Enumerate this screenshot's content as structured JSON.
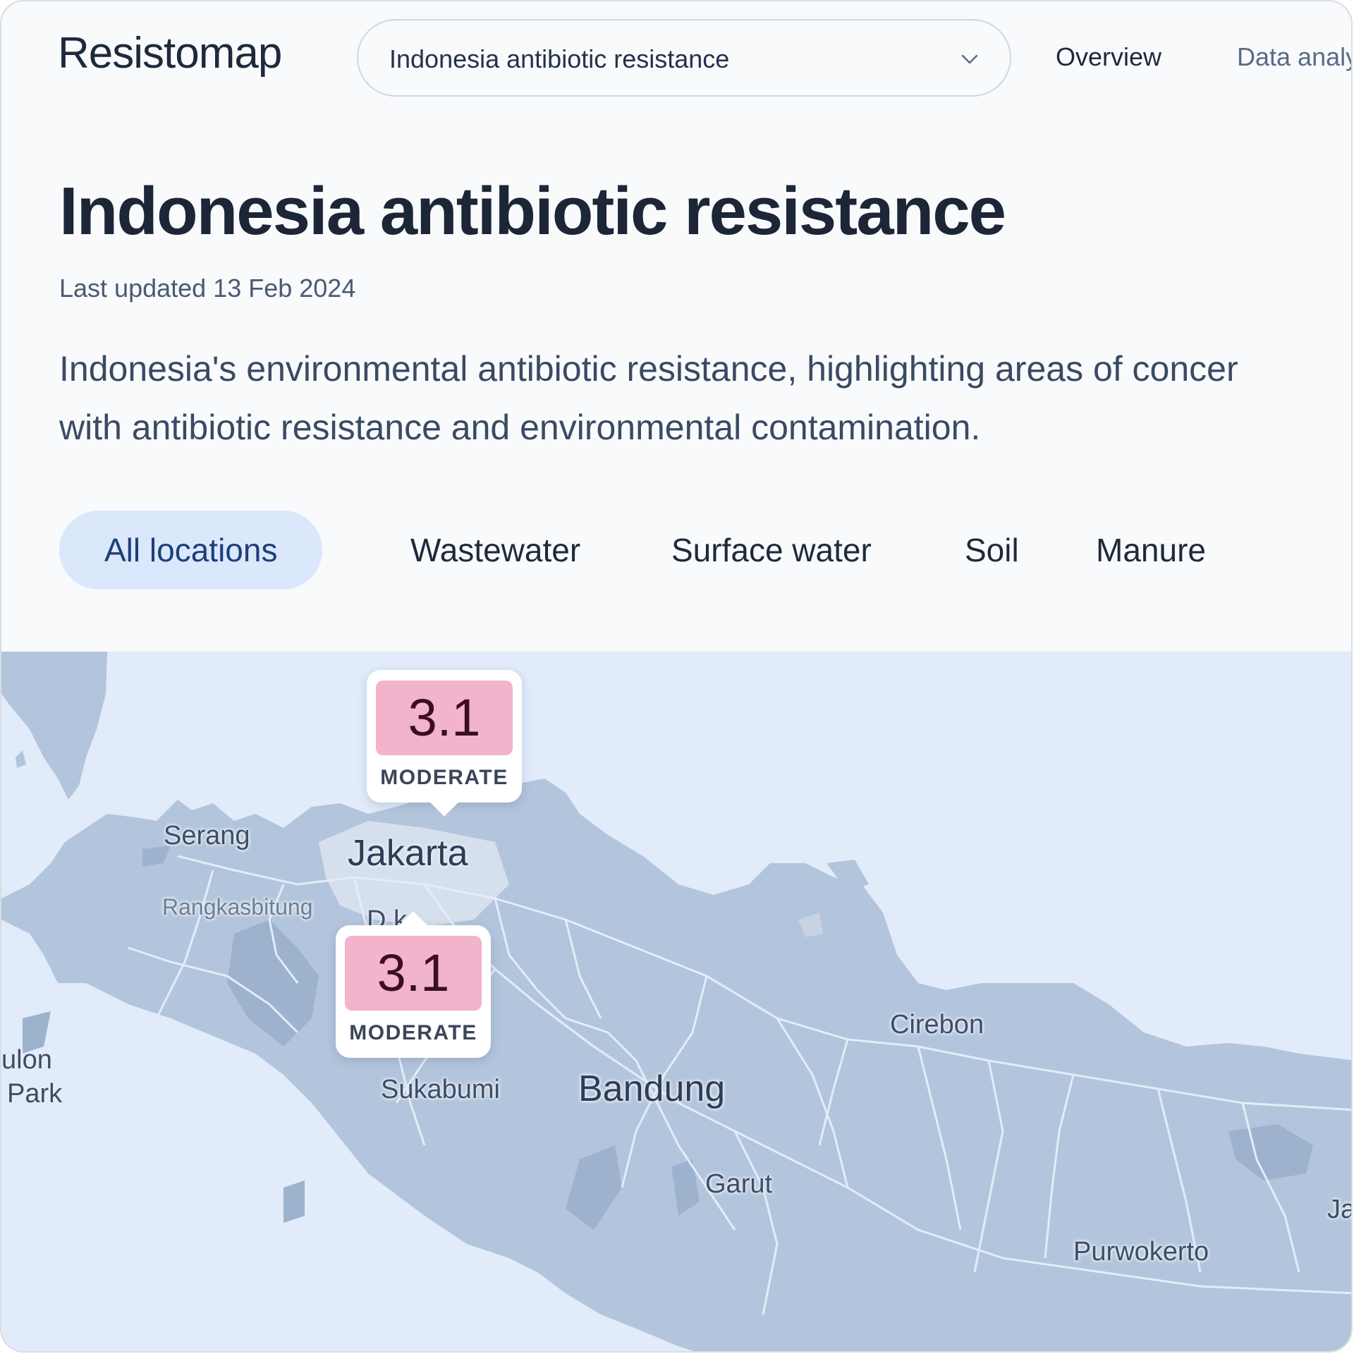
{
  "header": {
    "logo_text": "Resistomap",
    "dataset_select": {
      "value": "Indonesia antibiotic resistance",
      "icon": "chevron-down-icon"
    },
    "nav": [
      {
        "label": "Overview"
      },
      {
        "label": "Data analy"
      }
    ]
  },
  "main": {
    "title": "Indonesia antibiotic resistance",
    "last_updated": "Last updated 13 Feb 2024",
    "description_line1": "Indonesia's environmental antibiotic resistance, highlighting areas of concer",
    "description_line2": "with antibiotic resistance and environmental contamination.",
    "tabs": [
      {
        "label": "All locations",
        "active": true
      },
      {
        "label": "Wastewater",
        "active": false
      },
      {
        "label": "Surface water",
        "active": false
      },
      {
        "label": "Soil",
        "active": false
      },
      {
        "label": "Manure",
        "active": false
      }
    ]
  },
  "map": {
    "cities": {
      "jakarta": "Jakarta",
      "serang": "Serang",
      "rangkasbitung": "Rangkasbitung",
      "depok_partial": "D   k",
      "bandung": "Bandung",
      "sukabumi": "Sukabumi",
      "cirebon": "Cirebon",
      "garut": "Garut",
      "purwokerto": "Purwokerto",
      "ujung_kulon_1": "ulon",
      "ujung_kulon_2": "Park",
      "ja_partial": "Ja"
    },
    "markers": [
      {
        "score": "3.1",
        "level": "MODERATE",
        "color": "#f2b3cc"
      },
      {
        "score": "3.1",
        "level": "MODERATE",
        "color": "#f2b3cc"
      }
    ],
    "colors": {
      "sea": "#e1ebf9",
      "land": "#b3c5dc",
      "roads": "#e4ecf8",
      "urban": "#d6dfec"
    }
  }
}
